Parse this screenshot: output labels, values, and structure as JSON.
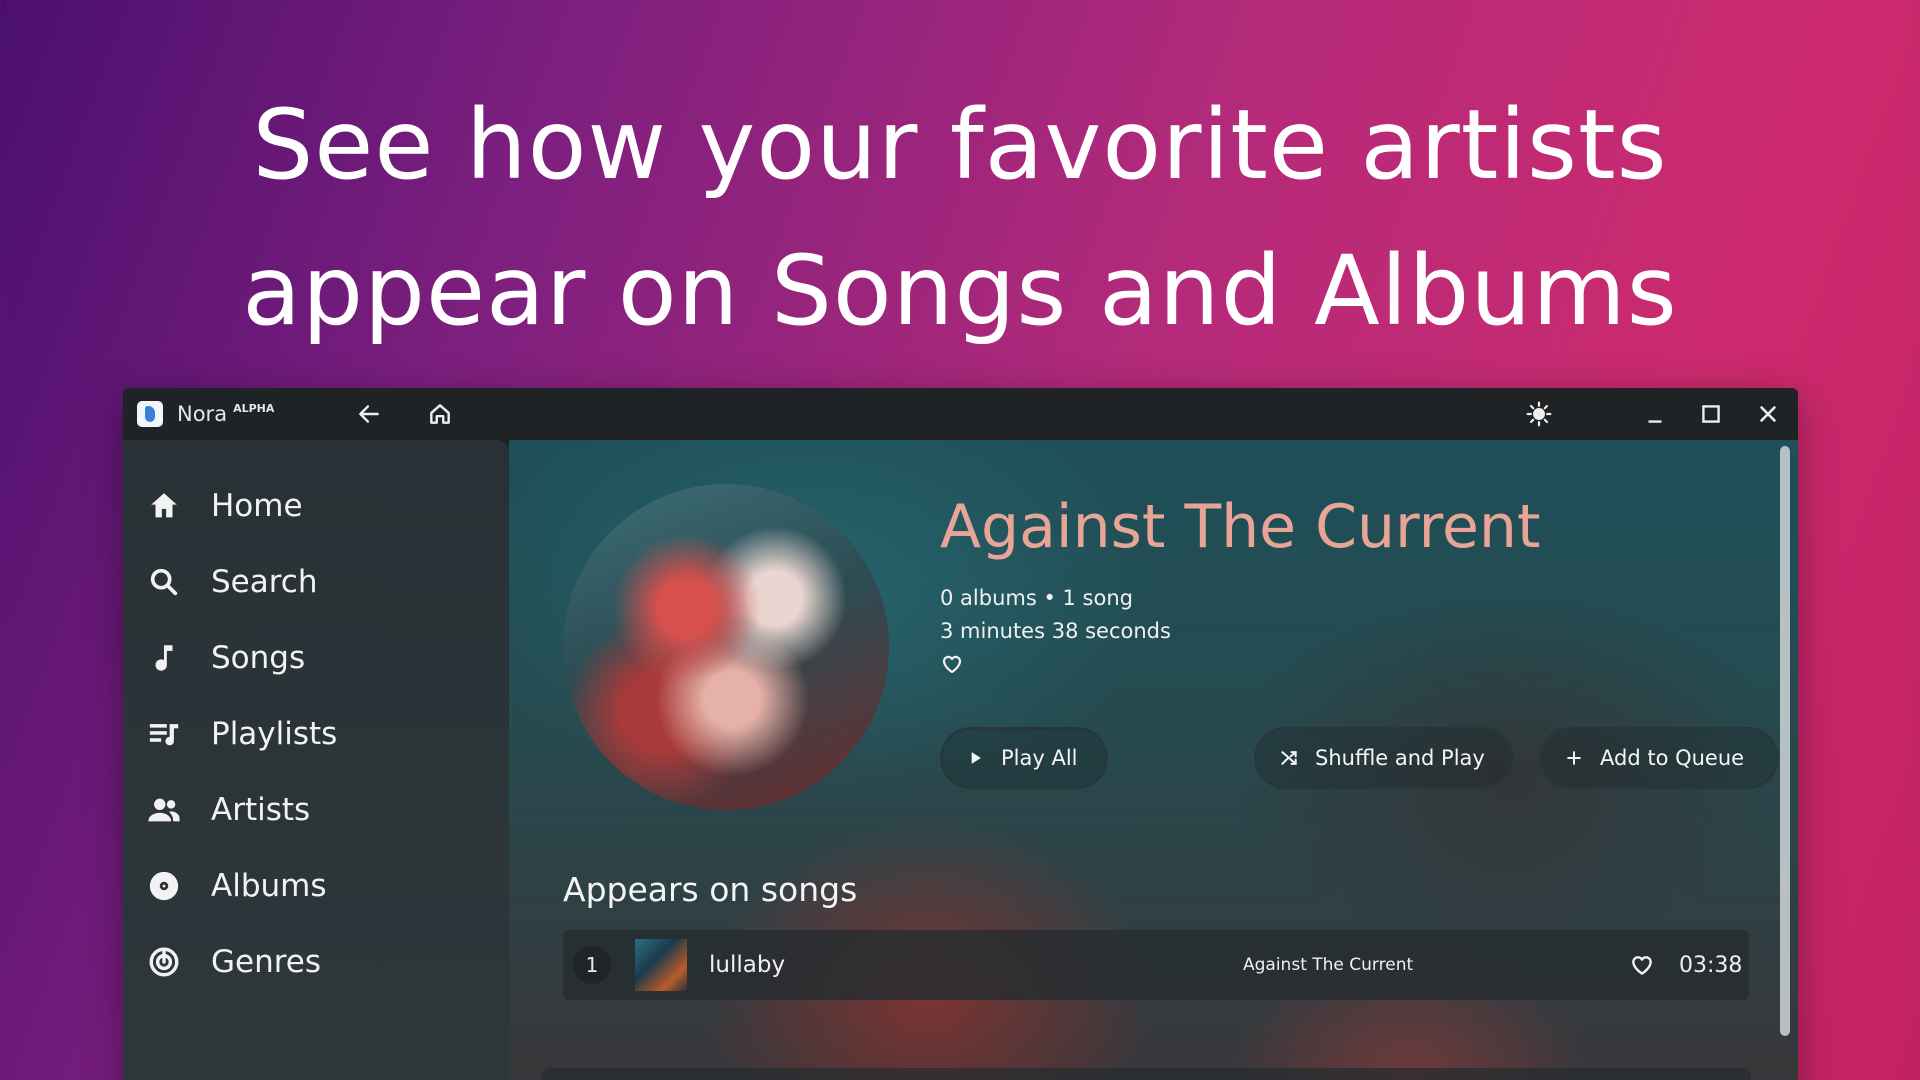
{
  "headline": {
    "line1": "See how your favorite artists",
    "line2": "appear on Songs and Albums"
  },
  "titlebar": {
    "app_name": "Nora",
    "app_badge": "ALPHA",
    "icons": [
      "back-arrow-icon",
      "home-icon",
      "brightness-icon",
      "minimize-icon",
      "maximize-icon",
      "close-icon"
    ]
  },
  "sidebar": {
    "items": [
      {
        "label": "Home",
        "icon": "home-icon"
      },
      {
        "label": "Search",
        "icon": "search-icon"
      },
      {
        "label": "Songs",
        "icon": "music-note-icon"
      },
      {
        "label": "Playlists",
        "icon": "playlist-icon"
      },
      {
        "label": "Artists",
        "icon": "people-icon"
      },
      {
        "label": "Albums",
        "icon": "album-disc-icon"
      },
      {
        "label": "Genres",
        "icon": "genre-icon"
      }
    ]
  },
  "artist": {
    "name": "Against The Current",
    "stats_line1": "0 albums • 1 song",
    "stats_line2": "3 minutes 38 seconds",
    "name_color": "#e8a597"
  },
  "actions": {
    "play_all": "Play All",
    "shuffle_and_play": "Shuffle and Play",
    "add_to_queue": "Add to Queue"
  },
  "songs_section": {
    "title": "Appears on songs",
    "songs": [
      {
        "index": "1",
        "title": "lullaby",
        "artist": "Against The Current",
        "duration": "03:38"
      }
    ]
  }
}
